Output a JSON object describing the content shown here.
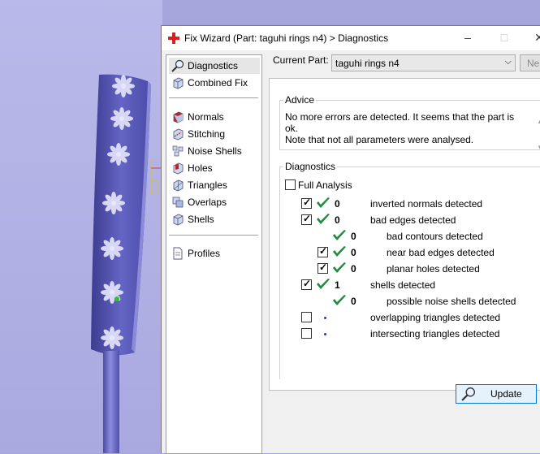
{
  "dialog": {
    "title": "Fix Wizard (Part: taguhi rings n4) > Diagnostics",
    "minimize": "–",
    "maximize": "□",
    "close": "✕"
  },
  "nav": {
    "top": [
      {
        "label": "Diagnostics",
        "icon": "magnifier-icon",
        "selected": true
      },
      {
        "label": "Combined Fix",
        "icon": "cube-icon",
        "selected": false
      }
    ],
    "fixes": [
      {
        "label": "Normals",
        "icon": "normals-icon"
      },
      {
        "label": "Stitching",
        "icon": "stitching-icon"
      },
      {
        "label": "Noise Shells",
        "icon": "noise-shells-icon"
      },
      {
        "label": "Holes",
        "icon": "holes-icon"
      },
      {
        "label": "Triangles",
        "icon": "triangles-icon"
      },
      {
        "label": "Overlaps",
        "icon": "overlaps-icon"
      },
      {
        "label": "Shells",
        "icon": "shells-icon"
      }
    ],
    "bottom": [
      {
        "label": "Profiles",
        "icon": "document-icon"
      }
    ]
  },
  "current_part": {
    "label": "Current Part:",
    "value": "taguhi rings n4",
    "next_label": "Ne"
  },
  "advice": {
    "title": "Advice",
    "line1": "No more errors are detected. It seems that the part is ok.",
    "line2": "Note that not all parameters were analysed."
  },
  "diagnostics": {
    "title": "Diagnostics",
    "full_analysis_label": "Full Analysis",
    "full_analysis_checked": false,
    "rows": [
      {
        "label": "inverted normals detected",
        "count": "0",
        "checked": true,
        "status": "ok",
        "indent": 0
      },
      {
        "label": "bad edges detected",
        "count": "0",
        "checked": true,
        "status": "ok",
        "indent": 0
      },
      {
        "label": "bad contours detected",
        "count": "0",
        "checked": null,
        "status": "ok",
        "indent": 1
      },
      {
        "label": "near bad edges detected",
        "count": "0",
        "checked": true,
        "status": "ok",
        "indent": 1
      },
      {
        "label": "planar holes detected",
        "count": "0",
        "checked": true,
        "status": "ok",
        "indent": 1
      },
      {
        "label": "shells detected",
        "count": "1",
        "checked": true,
        "status": "ok",
        "indent": 0
      },
      {
        "label": "possible noise shells detected",
        "count": "0",
        "checked": null,
        "status": "ok",
        "indent": 1
      },
      {
        "label": "overlapping triangles detected",
        "count": "",
        "checked": false,
        "status": "pending",
        "indent": 0
      },
      {
        "label": "intersecting triangles detected",
        "count": "",
        "checked": false,
        "status": "pending",
        "indent": 0
      }
    ],
    "update_label": "Update"
  },
  "colors": {
    "ring": "#5a5ab8",
    "check_green": "#1e8c3a",
    "button_border": "#0078d7"
  }
}
